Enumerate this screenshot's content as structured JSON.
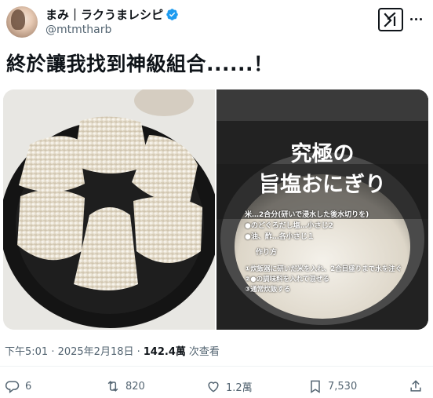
{
  "author": {
    "display_name": "まみ｜ラクうまレシピ",
    "handle": "@mtmtharb",
    "verified": true
  },
  "header_icons": {
    "grok_button": "xai-grok-icon",
    "more_button": "more-icon"
  },
  "tweet": {
    "text": "終於讓我找到神級組合......！"
  },
  "media": {
    "left_image": "onigiri-plate-photo",
    "right_image": {
      "title_line1": "究極の",
      "title_line2": "旨塩おにぎり",
      "ingredients": [
        "米…2合分(研いで浸水した後水切りを)",
        "●のどぐろだし塩…小さじ2",
        "●油、酢…各小さじ１"
      ],
      "method_heading": "作り方",
      "steps": [
        "①炊飯器に研いだ米を入れ、2合目盛りまで水を注ぐ",
        "②●の調味料を入れて混ぜる",
        "③通常炊飯する"
      ]
    }
  },
  "meta": {
    "time": "下午5:01 · 2025年2月18日 ·",
    "views": "142.4萬",
    "views_label": "次查看"
  },
  "actions": {
    "replies": "6",
    "retweets": "820",
    "likes": "1.2萬",
    "bookmarks": "7,530"
  }
}
